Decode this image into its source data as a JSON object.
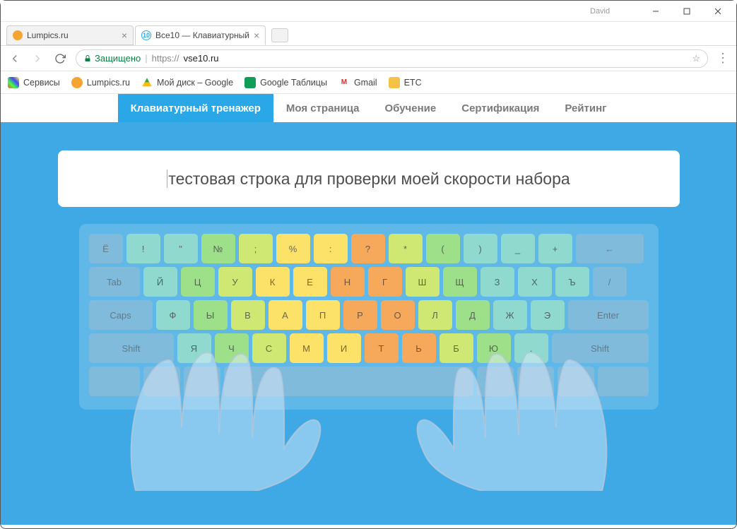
{
  "window": {
    "user": "David"
  },
  "tabs": [
    {
      "label": "Lumpics.ru",
      "active": false
    },
    {
      "label": "Все10 — Клавиатурный",
      "active": true,
      "badge": "10"
    }
  ],
  "address": {
    "secure_label": "Защищено",
    "scheme": "https://",
    "host": "vse10.ru"
  },
  "bookmarks": [
    {
      "label": "Сервисы"
    },
    {
      "label": "Lumpics.ru"
    },
    {
      "label": "Мой диск – Google"
    },
    {
      "label": "Google Таблицы"
    },
    {
      "label": "Gmail"
    },
    {
      "label": "ETC"
    }
  ],
  "sitenav": [
    {
      "label": "Клавиатурный тренажер",
      "active": true
    },
    {
      "label": "Моя страница"
    },
    {
      "label": "Обучение"
    },
    {
      "label": "Сертификация"
    },
    {
      "label": "Рейтинг"
    }
  ],
  "typing_text": "тестовая строка для проверки моей скорости набора",
  "keyboard": {
    "row1": [
      {
        "l": "Ё",
        "c": "gray"
      },
      {
        "l": "!",
        "c": "teal"
      },
      {
        "l": "\"",
        "c": "teal"
      },
      {
        "l": "№",
        "c": "green"
      },
      {
        "l": ";",
        "c": "lime"
      },
      {
        "l": "%",
        "c": "yellow"
      },
      {
        "l": ":",
        "c": "yellow"
      },
      {
        "l": "?",
        "c": "orange"
      },
      {
        "l": "*",
        "c": "lime"
      },
      {
        "l": "(",
        "c": "green"
      },
      {
        "l": ")",
        "c": "teal"
      },
      {
        "l": "_",
        "c": "teal"
      },
      {
        "l": "+",
        "c": "teal"
      },
      {
        "l": "←",
        "c": "gray",
        "w": "wback"
      }
    ],
    "row2_tab": "Tab",
    "row2": [
      {
        "l": "Й",
        "c": "teal"
      },
      {
        "l": "Ц",
        "c": "green"
      },
      {
        "l": "У",
        "c": "lime"
      },
      {
        "l": "К",
        "c": "yellow"
      },
      {
        "l": "Е",
        "c": "yellow"
      },
      {
        "l": "Н",
        "c": "orange"
      },
      {
        "l": "Г",
        "c": "orange"
      },
      {
        "l": "Ш",
        "c": "lime"
      },
      {
        "l": "Щ",
        "c": "green"
      },
      {
        "l": "З",
        "c": "teal"
      },
      {
        "l": "Х",
        "c": "teal"
      },
      {
        "l": "Ъ",
        "c": "teal"
      },
      {
        "l": "/",
        "c": "gray"
      }
    ],
    "row3_caps": "Caps",
    "row3_enter": "Enter",
    "row3": [
      {
        "l": "Ф",
        "c": "teal"
      },
      {
        "l": "Ы",
        "c": "green"
      },
      {
        "l": "В",
        "c": "lime"
      },
      {
        "l": "А",
        "c": "yellow"
      },
      {
        "l": "П",
        "c": "yellow"
      },
      {
        "l": "Р",
        "c": "orange"
      },
      {
        "l": "О",
        "c": "orange"
      },
      {
        "l": "Л",
        "c": "lime"
      },
      {
        "l": "Д",
        "c": "green"
      },
      {
        "l": "Ж",
        "c": "teal"
      },
      {
        "l": "Э",
        "c": "teal"
      }
    ],
    "row4_shift_l": "Shift",
    "row4_shift_r": "Shift",
    "row4": [
      {
        "l": "Я",
        "c": "teal"
      },
      {
        "l": "Ч",
        "c": "green"
      },
      {
        "l": "С",
        "c": "lime"
      },
      {
        "l": "М",
        "c": "yellow"
      },
      {
        "l": "И",
        "c": "yellow"
      },
      {
        "l": "Т",
        "c": "orange"
      },
      {
        "l": "Ь",
        "c": "orange"
      },
      {
        "l": "Б",
        "c": "lime"
      },
      {
        "l": "Ю",
        "c": "green"
      },
      {
        "l": ".",
        "c": "teal"
      }
    ]
  }
}
